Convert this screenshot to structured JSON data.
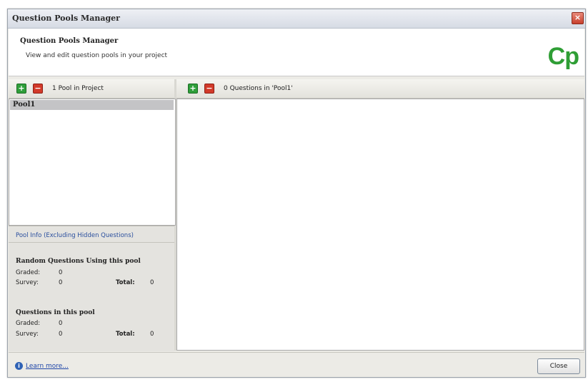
{
  "window": {
    "title": "Question Pools Manager",
    "close_glyph": "×"
  },
  "header": {
    "title": "Question Pools Manager",
    "description": "View and edit question pools in your project",
    "logo_text": "Cp"
  },
  "left_panel": {
    "add_icon": "+",
    "remove_icon": "−",
    "count_label": "1 Pool in Project",
    "pools": [
      "Pool1"
    ]
  },
  "right_panel": {
    "add_icon": "+",
    "remove_icon": "−",
    "count_label": "0 Questions in 'Pool1'"
  },
  "pool_info": {
    "header": "Pool Info (Excluding Hidden Questions)",
    "random": {
      "title": "Random Questions Using this pool",
      "graded_label": "Graded:",
      "graded_value": "0",
      "survey_label": "Survey:",
      "survey_value": "0",
      "total_label": "Total:",
      "total_value": "0"
    },
    "questions": {
      "title": "Questions in this pool",
      "graded_label": "Graded:",
      "graded_value": "0",
      "survey_label": "Survey:",
      "survey_value": "0",
      "total_label": "Total:",
      "total_value": "0"
    }
  },
  "footer": {
    "help_icon": "i",
    "learn_more": "Learn more...",
    "close_button": "Close"
  },
  "colors": {
    "accent_green": "#2f9e3a",
    "accent_red": "#d23a2a",
    "link_blue": "#1f46a8",
    "logo_green": "#2f9e35"
  }
}
